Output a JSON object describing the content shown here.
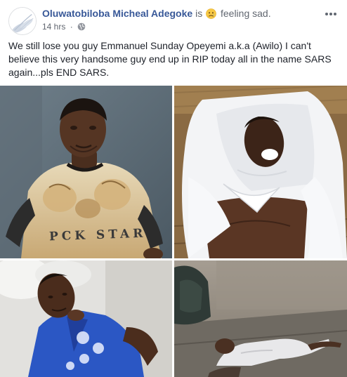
{
  "post": {
    "author": "Oluwatobiloba Micheal Adegoke",
    "is_word": "is",
    "feeling": "feeling sad.",
    "time": "14 hrs",
    "separator": "·",
    "privacy_icon": "globe-icon",
    "more_icon": "more-options-icon",
    "text": "We still lose you guy Emmanuel Sunday Opeyemi a.k.a (Awilo) I can't believe this very handsome guy end up in RIP today all in the name SARS again...pls END SARS."
  },
  "photos": {
    "photo1_shirt_text": "PCK STAR"
  },
  "colors": {
    "link_blue": "#385898",
    "meta_grey": "#616770",
    "text": "#1d2129"
  }
}
